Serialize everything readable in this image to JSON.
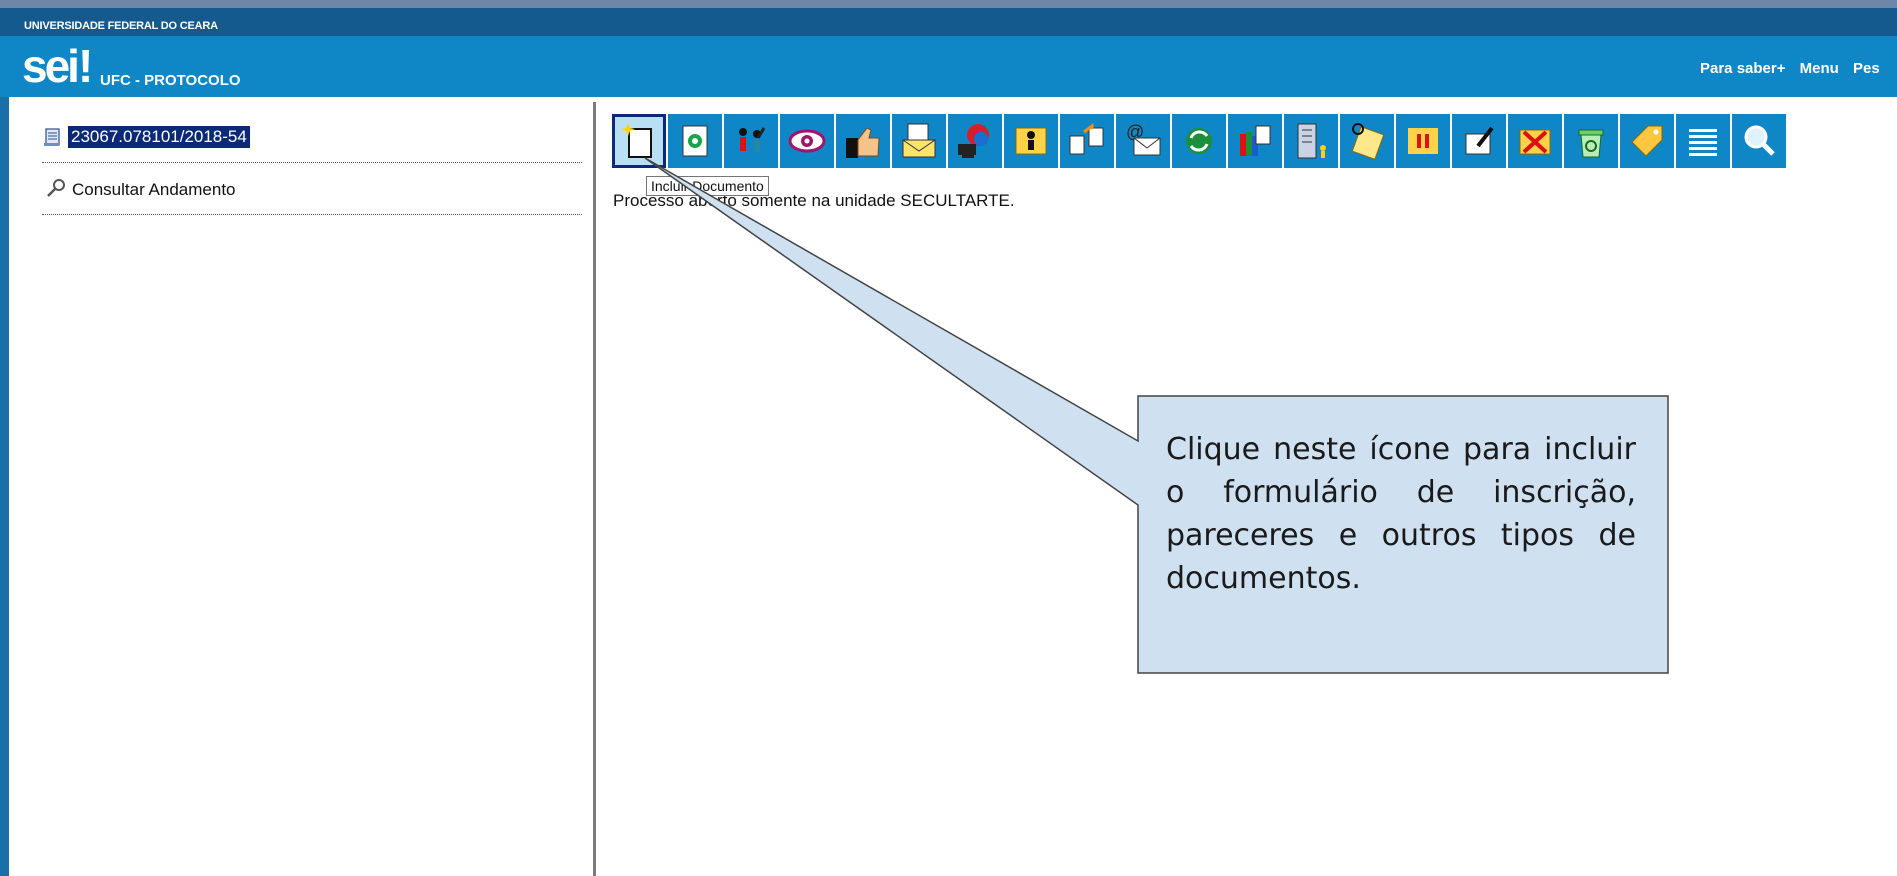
{
  "header": {
    "org": "UNIVERSIDADE FEDERAL DO CEARA",
    "logo": "sei",
    "logo_mark": "!",
    "system": "UFC - PROTOCOLO",
    "links": [
      "Para saber+",
      "Menu",
      "Pes"
    ]
  },
  "tree": {
    "process_number": "23067.078101/2018-54",
    "consult_link": "Consultar Andamento"
  },
  "toolbar": {
    "icons": [
      "new-document-icon",
      "scanned-document-icon",
      "people-icon",
      "eye-icon",
      "thumbs-up-icon",
      "envelope-document-icon",
      "globe-computer-icon",
      "folder-person-icon",
      "document-transfer-icon",
      "at-email-icon",
      "refresh-icon",
      "books-icon",
      "building-icon",
      "signature-icon",
      "pause-icon",
      "pen-paper-icon",
      "folder-cancel-icon",
      "recycle-bin-icon",
      "tag-icon",
      "list-icon",
      "search-icon"
    ],
    "tooltip": "Incluir Documento"
  },
  "status": "Processo aberto somente na unidade SECULTARTE.",
  "callout": {
    "text": "Clique neste ícone para incluir o formulário de inscrição, pareceres e outros tipos de documentos."
  },
  "colors": {
    "header_blue": "#0f86c6",
    "org_bar": "#155a8f",
    "callout_fill": "#cfe0f1",
    "selection": "#0a2a78"
  }
}
